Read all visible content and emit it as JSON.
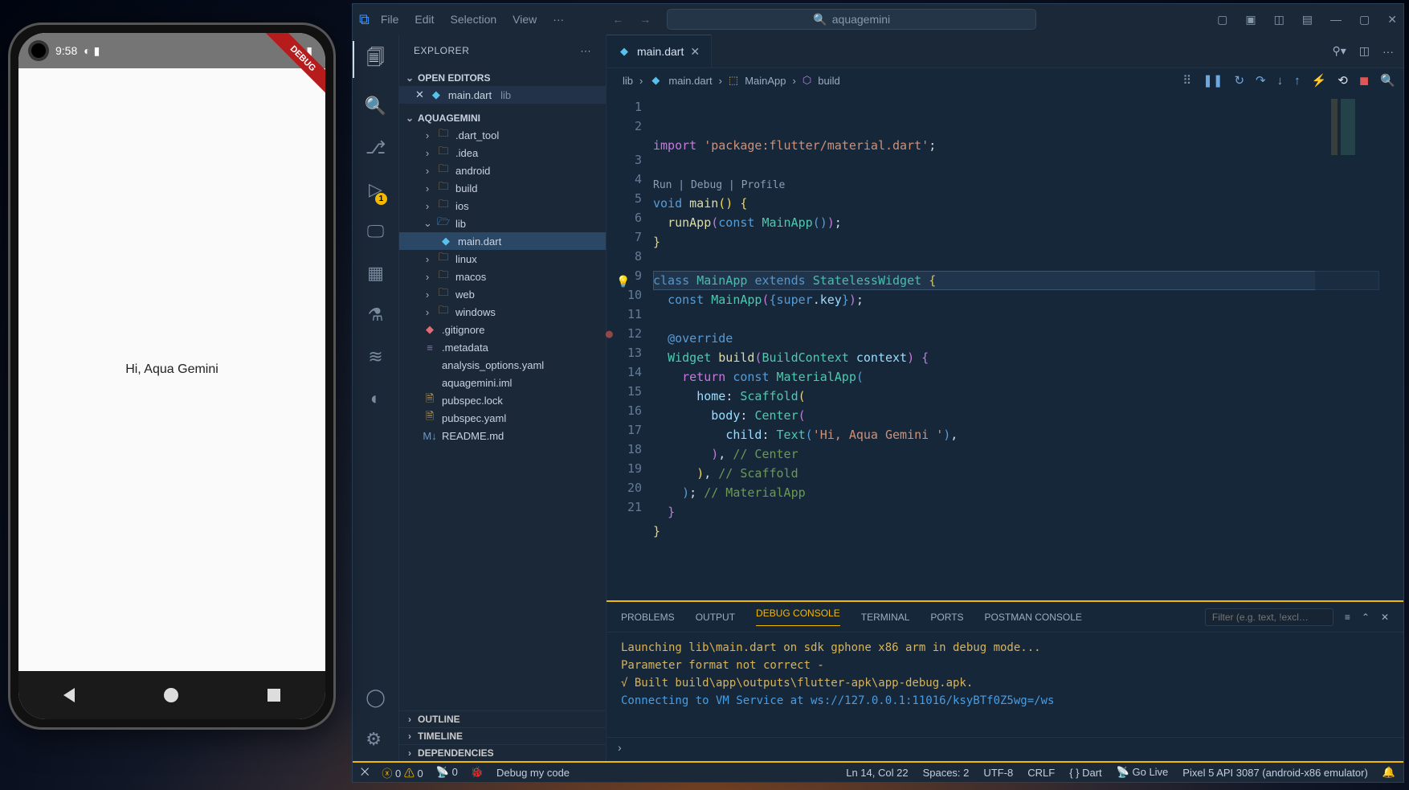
{
  "emulator": {
    "time": "9:58",
    "appText": "Hi, Aqua Gemini"
  },
  "titlebar": {
    "menus": [
      "File",
      "Edit",
      "Selection",
      "View",
      "···"
    ],
    "searchText": "aquagemini"
  },
  "explorer": {
    "title": "EXPLORER",
    "openEditors": "OPEN EDITORS",
    "project": "AQUAGEMINI",
    "openFile": "main.dart",
    "openFileHint": "lib",
    "tree": [
      {
        "t": "folder",
        "name": ".dart_tool"
      },
      {
        "t": "folder",
        "name": ".idea"
      },
      {
        "t": "folder",
        "name": "android"
      },
      {
        "t": "folder",
        "name": "build"
      },
      {
        "t": "folder",
        "name": "ios"
      },
      {
        "t": "folder-open",
        "name": "lib"
      },
      {
        "t": "dart",
        "name": "main.dart",
        "sel": true,
        "l": 2
      },
      {
        "t": "folder",
        "name": "linux"
      },
      {
        "t": "folder",
        "name": "macos"
      },
      {
        "t": "folder",
        "name": "web"
      },
      {
        "t": "folder",
        "name": "windows"
      },
      {
        "t": "git",
        "name": ".gitignore",
        "leaf": true
      },
      {
        "t": "meta",
        "name": ".metadata",
        "leaf": true
      },
      {
        "t": "yaml",
        "name": "analysis_options.yaml",
        "leaf": true
      },
      {
        "t": "yaml",
        "name": "aquagemini.iml",
        "leaf": true
      },
      {
        "t": "lock",
        "name": "pubspec.lock",
        "leaf": true
      },
      {
        "t": "lock",
        "name": "pubspec.yaml",
        "leaf": true
      },
      {
        "t": "md",
        "name": "README.md",
        "leaf": true
      }
    ],
    "outline": "OUTLINE",
    "timeline": "TIMELINE",
    "dependencies": "DEPENDENCIES"
  },
  "tab": {
    "name": "main.dart"
  },
  "crumbs": {
    "a": "lib",
    "b": "main.dart",
    "c": "MainApp",
    "d": "build"
  },
  "codelens": "Run | Debug | Profile",
  "lines": [
    "1",
    "2",
    "3",
    "4",
    "5",
    "6",
    "7",
    "8",
    "9",
    "10",
    "11",
    "12",
    "13",
    "14",
    "15",
    "16",
    "17",
    "18",
    "19",
    "20",
    "21"
  ],
  "panel": {
    "tabs": [
      "PROBLEMS",
      "OUTPUT",
      "DEBUG CONSOLE",
      "TERMINAL",
      "PORTS",
      "POSTMAN CONSOLE"
    ],
    "filterPh": "Filter (e.g. text, !excl…",
    "l1": "Launching lib\\main.dart on sdk gphone x86 arm in debug mode...",
    "l2": "Parameter format not correct -",
    "l3": "√  Built build\\app\\outputs\\flutter-apk\\app-debug.apk.",
    "l4": "Connecting to VM Service at ws://127.0.0.1:11016/ksyBTf0Z5wg=/ws"
  },
  "status": {
    "errs": "0",
    "warns": "0",
    "ports": "0",
    "debug": "Debug my code",
    "pos": "Ln 14, Col 22",
    "spaces": "Spaces: 2",
    "enc": "UTF-8",
    "eol": "CRLF",
    "lang": "Dart",
    "live": "Go Live",
    "device": "Pixel 5 API 3087 (android-x86 emulator)"
  }
}
